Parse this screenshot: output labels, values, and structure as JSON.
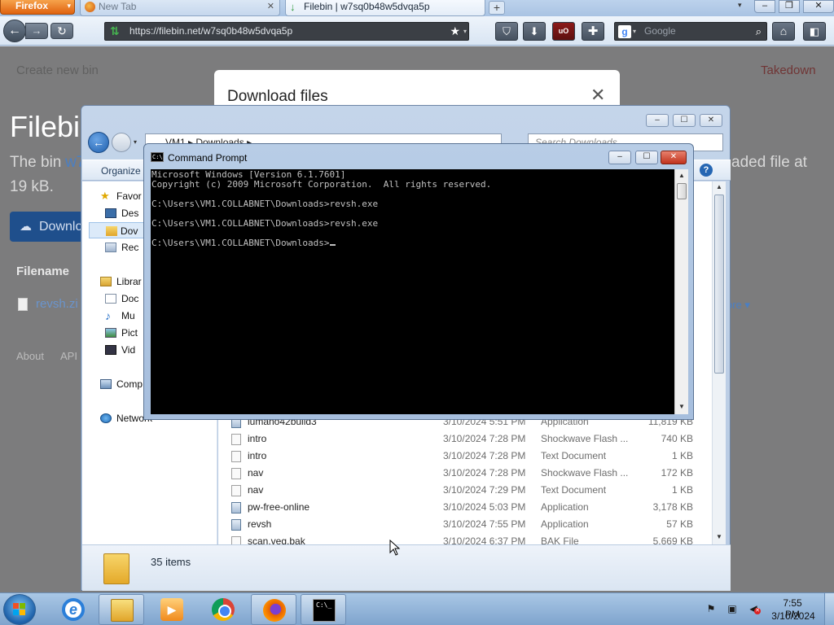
{
  "browser": {
    "menu_label": "Firefox",
    "tabs": [
      {
        "title": "New Tab"
      },
      {
        "title": "Filebin | w7sq0b48w5dvqa5p"
      }
    ],
    "url": "https://filebin.net/w7sq0b48w5dvqa5p",
    "search_placeholder": "Google",
    "search_engine_letter": "g"
  },
  "webpage": {
    "nav_create": "Create new bin",
    "nav_takedown": "Takedown",
    "heading_visible": "Filebi",
    "bin_text_prefix": "The bin",
    "bin_link_visible": "w7",
    "bin_text_suffix": "aded file at",
    "size_text": "19 kB.",
    "download_button_visible": "Downlo",
    "filename_header": "Filename",
    "file_link_visible": "revsh.zi",
    "more_link": "ore",
    "footer_about": "About",
    "footer_api": "API",
    "modal_title": "Download files"
  },
  "explorer": {
    "address": "VM1 ▸ Downloads ▸",
    "search_placeholder": "Search Downloads",
    "organize_label": "Organize",
    "nav_items": [
      {
        "label": "Favor",
        "icon": "star-icon"
      },
      {
        "label": "Des",
        "icon": "desktop-icon"
      },
      {
        "label": "Dov",
        "icon": "downloads-folder-icon"
      },
      {
        "label": "Rec",
        "icon": "recent-places-icon"
      },
      {
        "label": "Librar",
        "icon": "libraries-icon"
      },
      {
        "label": "Doc",
        "icon": "documents-icon"
      },
      {
        "label": "Mu",
        "icon": "music-icon"
      },
      {
        "label": "Pict",
        "icon": "pictures-icon"
      },
      {
        "label": "Vid",
        "icon": "videos-icon"
      },
      {
        "label": "Comp",
        "icon": "computer-icon"
      },
      {
        "label": "Network",
        "icon": "network-icon"
      }
    ],
    "files": [
      {
        "name": "lumano42build3",
        "date": "3/10/2024 5:51 PM",
        "type": "Application",
        "size": "11,819 KB",
        "kind": "app"
      },
      {
        "name": "intro",
        "date": "3/10/2024 7:28 PM",
        "type": "Shockwave Flash ...",
        "size": "740 KB",
        "kind": "file"
      },
      {
        "name": "intro",
        "date": "3/10/2024 7:28 PM",
        "type": "Text Document",
        "size": "1 KB",
        "kind": "file"
      },
      {
        "name": "nav",
        "date": "3/10/2024 7:28 PM",
        "type": "Shockwave Flash ...",
        "size": "172 KB",
        "kind": "file"
      },
      {
        "name": "nav",
        "date": "3/10/2024 7:29 PM",
        "type": "Text Document",
        "size": "1 KB",
        "kind": "file"
      },
      {
        "name": "pw-free-online",
        "date": "3/10/2024 5:03 PM",
        "type": "Application",
        "size": "3,178 KB",
        "kind": "app"
      },
      {
        "name": "revsh",
        "date": "3/10/2024 7:55 PM",
        "type": "Application",
        "size": "57 KB",
        "kind": "app"
      },
      {
        "name": "scan.veg.bak",
        "date": "3/10/2024 6:37 PM",
        "type": "BAK File",
        "size": "5,669 KB",
        "kind": "file"
      }
    ],
    "item_count": "35 items"
  },
  "cmd": {
    "title": "Command Prompt",
    "lines": [
      "Microsoft Windows [Version 6.1.7601]",
      "Copyright (c) 2009 Microsoft Corporation.  All rights reserved.",
      "",
      "C:\\Users\\VM1.COLLABNET\\Downloads>revsh.exe",
      "",
      "C:\\Users\\VM1.COLLABNET\\Downloads>revsh.exe",
      "",
      "C:\\Users\\VM1.COLLABNET\\Downloads>"
    ]
  },
  "taskbar": {
    "time": "7:55 PM",
    "date": "3/10/2024"
  }
}
